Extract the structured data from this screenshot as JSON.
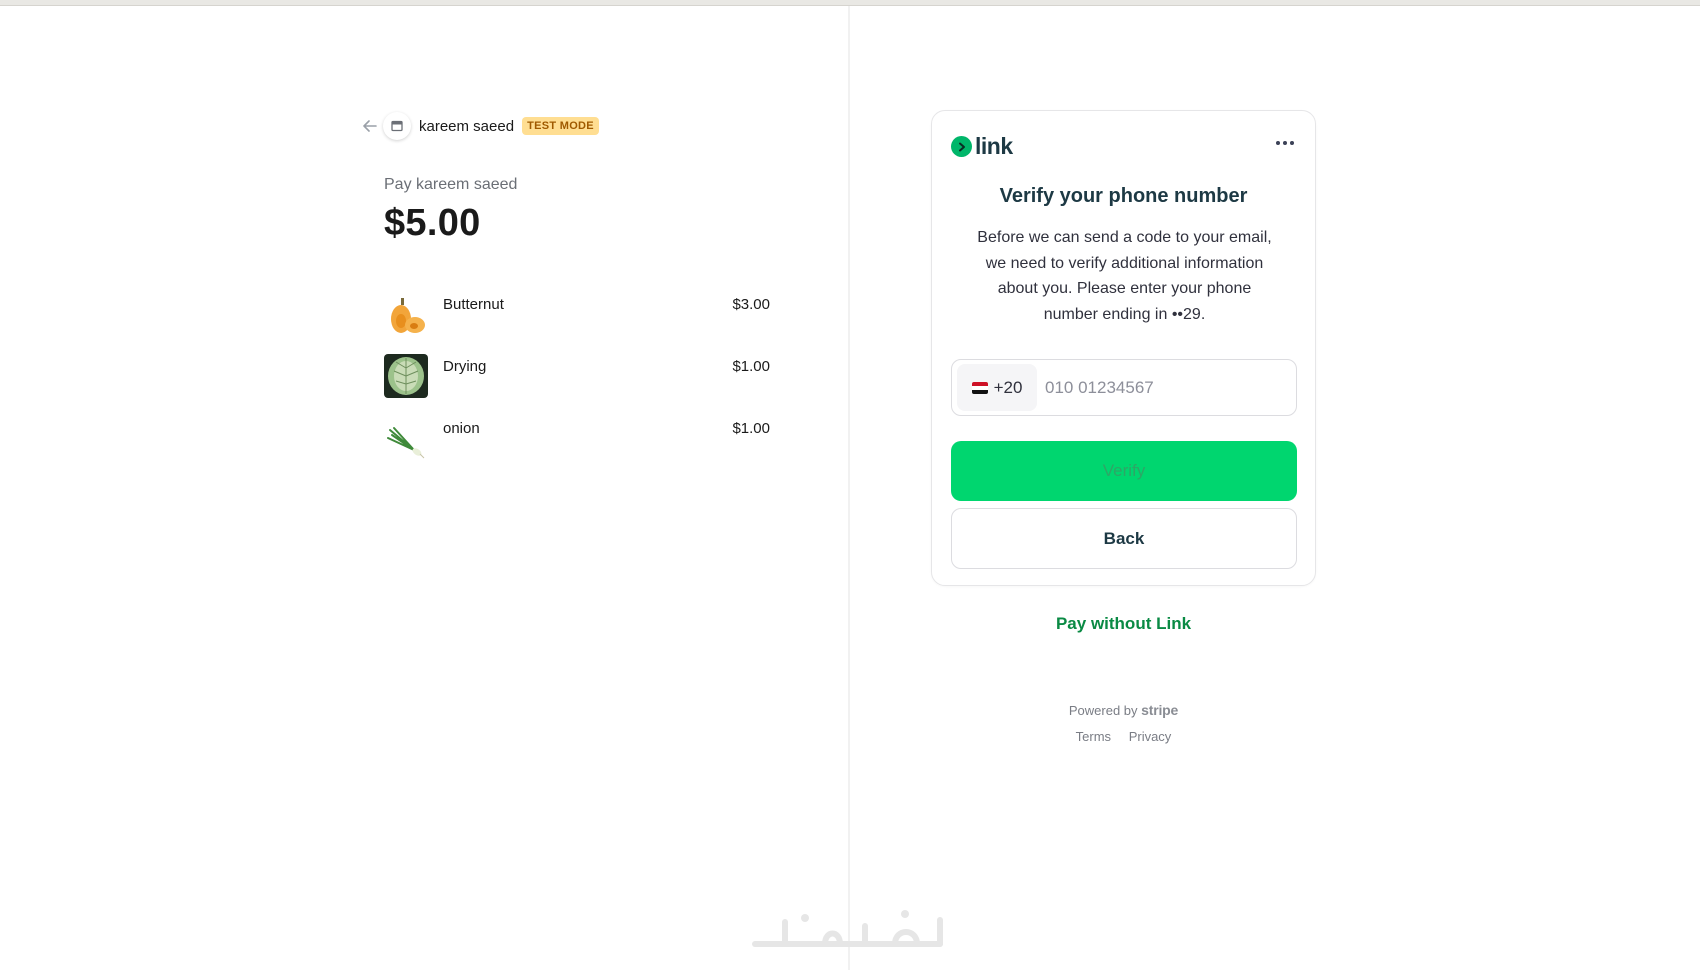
{
  "merchant": {
    "name": "kareem saeed",
    "test_badge": "TEST MODE"
  },
  "summary": {
    "pay_label": "Pay kareem saeed",
    "amount": "$5.00",
    "items": [
      {
        "name": "Butternut",
        "price": "$3.00"
      },
      {
        "name": "Drying",
        "price": "$1.00"
      },
      {
        "name": "onion",
        "price": "$1.00"
      }
    ]
  },
  "link_card": {
    "logo_text": "link",
    "title": "Verify your phone number",
    "description": "Before we can send a code to your email, we need to verify additional information about you. Please enter your phone number ending in ••29.",
    "country_code": "+20",
    "phone_placeholder": "010 01234567",
    "verify_label": "Verify",
    "back_label": "Back"
  },
  "pay_without_link": "Pay without Link",
  "footer": {
    "powered_by": "Powered by",
    "stripe": "stripe",
    "terms": "Terms",
    "privacy": "Privacy"
  },
  "colors": {
    "link_green": "#00d66f",
    "link_dark": "#1d3944",
    "badge_bg": "#ffde92"
  }
}
